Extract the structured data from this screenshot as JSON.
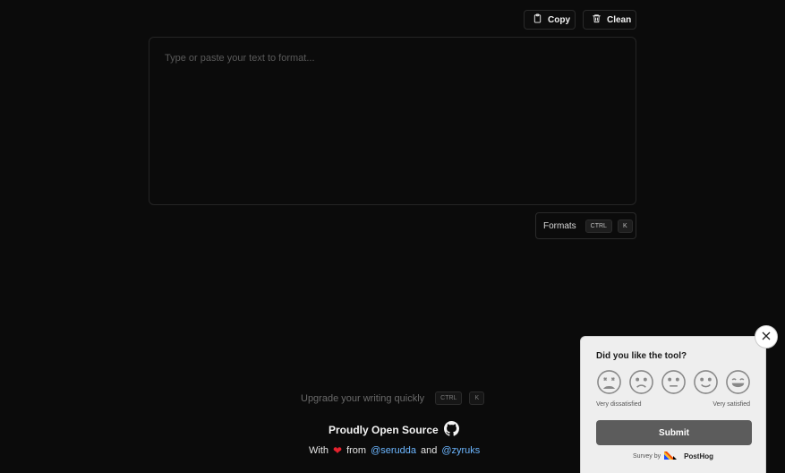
{
  "toolbar": {
    "copy_label": "Copy",
    "clean_label": "Clean"
  },
  "editor": {
    "placeholder": "Type or paste your text to format...",
    "value": ""
  },
  "formats": {
    "label": "Formats",
    "shortcut": [
      "CTRL",
      "K"
    ]
  },
  "footer": {
    "upgrade_text": "Upgrade your writing quickly",
    "upgrade_shortcut": [
      "CTRL",
      "K"
    ],
    "proud_text": "Proudly Open Source",
    "with_text": "With",
    "from_text": "from",
    "and_text": "and",
    "author1": "@serudda",
    "author2": "@zyruks"
  },
  "survey": {
    "question": "Did you like the tool?",
    "ratings": [
      "very-dissatisfied-icon",
      "dissatisfied-icon",
      "neutral-icon",
      "satisfied-icon",
      "very-satisfied-icon"
    ],
    "low_label": "Very dissatisfied",
    "high_label": "Very satisfied",
    "submit_label": "Submit",
    "powered_prefix": "Survey by",
    "powered_brand": "PostHog"
  },
  "colors": {
    "background": "#0b0b0b",
    "link": "#6cb6ff",
    "heart": "#e5222e",
    "survey_bg": "#eeeeee",
    "submit_bg": "#5c5c5c"
  }
}
